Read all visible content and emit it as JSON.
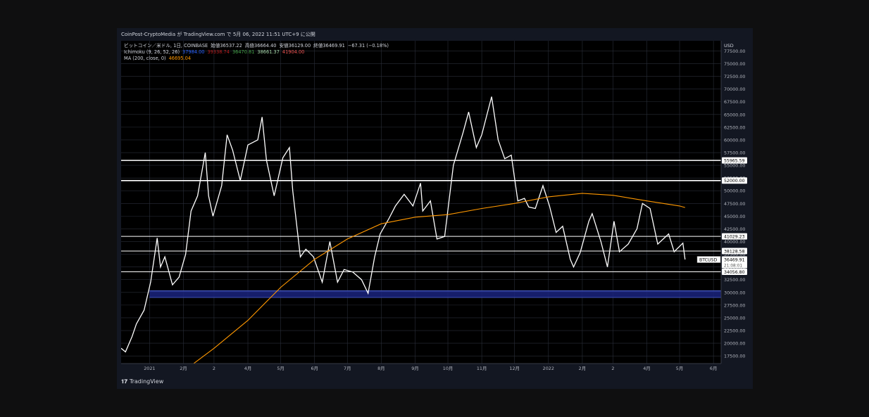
{
  "header": {
    "publisher": "CoinPost-CryptoMedia が TradingView.com で 5月 06, 2022 11:51 UTC+9 に公開"
  },
  "legend": {
    "symbol_line": "ビットコイン／米ドル, 1日, COINBASE",
    "ohlc": [
      {
        "label": "始値",
        "value": "36537.22"
      },
      {
        "label": "高値",
        "value": "36664.40"
      },
      {
        "label": "安値",
        "value": "36129.00"
      },
      {
        "label": "終値",
        "value": "36469.91"
      }
    ],
    "change": "−67.31 (−0.18%)",
    "ichimoku_label": "Ichimoku (9, 26, 52, 26)",
    "ichimoku_values": [
      {
        "value": "37984.00",
        "color": "#2962ff"
      },
      {
        "value": "39338.74",
        "color": "#b71c1c"
      },
      {
        "value": "36470.81",
        "color": "#43a047"
      },
      {
        "value": "38661.37",
        "color": "#a5d6a7"
      },
      {
        "value": "41904.00",
        "color": "#ef5350"
      }
    ],
    "ma_label": "MA (200, close, 0)",
    "ma_value": "46695.04",
    "ma_color": "#ff9800"
  },
  "currency": "USD",
  "footer": {
    "brand": "TradingView",
    "icon": "tradingview-logo-icon"
  },
  "chart_data": {
    "type": "line",
    "title": "",
    "xlabel": "",
    "ylabel": "",
    "ylim": [
      16000,
      79500
    ],
    "y_ticks": [
      17500,
      20000,
      22500,
      25000,
      27500,
      30000,
      32500,
      35000,
      37500,
      40000,
      42500,
      45000,
      47500,
      50000,
      52500,
      55000,
      57500,
      60000,
      62500,
      65000,
      67500,
      70000,
      72500,
      75000,
      77500
    ],
    "x_ticks": [
      {
        "label": "2021",
        "date": "2021-01-01"
      },
      {
        "label": "2月",
        "date": "2021-02-01"
      },
      {
        "label": "2",
        "date": "2021-03-01"
      },
      {
        "label": "4月",
        "date": "2021-04-01"
      },
      {
        "label": "5月",
        "date": "2021-05-01"
      },
      {
        "label": "6月",
        "date": "2021-06-01"
      },
      {
        "label": "7月",
        "date": "2021-07-01"
      },
      {
        "label": "8月",
        "date": "2021-08-01"
      },
      {
        "label": "9月",
        "date": "2021-09-01"
      },
      {
        "label": "10月",
        "date": "2021-10-01"
      },
      {
        "label": "11月",
        "date": "2021-11-01"
      },
      {
        "label": "12月",
        "date": "2021-12-01"
      },
      {
        "label": "2022",
        "date": "2022-01-01"
      },
      {
        "label": "2月",
        "date": "2022-02-01"
      },
      {
        "label": "2",
        "date": "2022-03-01"
      },
      {
        "label": "4月",
        "date": "2022-04-01"
      },
      {
        "label": "5月",
        "date": "2022-05-01"
      },
      {
        "label": "6月",
        "date": "2022-06-01"
      }
    ],
    "x_range": [
      "2020-12-06",
      "2022-06-08"
    ],
    "horizontal_levels": [
      {
        "value": 55965.59,
        "label": "55965.59"
      },
      {
        "value": 52000.0,
        "label": "52000.00"
      },
      {
        "value": 41029.23,
        "label": "41029.23"
      },
      {
        "value": 38128.58,
        "label": "38128.58"
      },
      {
        "value": 34056.8,
        "label": "34056.80"
      }
    ],
    "support_zone": {
      "from": 29000,
      "to": 30300,
      "color": "#1a237e"
    },
    "price_tag": {
      "symbol": "BTCUSD",
      "value": "36469.91",
      "countdown": "21:08:01"
    },
    "series": [
      {
        "name": "BTCUSD",
        "color": "#ffffff",
        "points": [
          [
            "2020-12-06",
            19000
          ],
          [
            "2020-12-10",
            18300
          ],
          [
            "2020-12-16",
            21300
          ],
          [
            "2020-12-20",
            23800
          ],
          [
            "2020-12-27",
            26500
          ],
          [
            "2021-01-02",
            32000
          ],
          [
            "2021-01-08",
            40700
          ],
          [
            "2021-01-11",
            35000
          ],
          [
            "2021-01-15",
            37000
          ],
          [
            "2021-01-22",
            31500
          ],
          [
            "2021-01-28",
            33000
          ],
          [
            "2021-02-03",
            37500
          ],
          [
            "2021-02-08",
            46000
          ],
          [
            "2021-02-14",
            49000
          ],
          [
            "2021-02-21",
            57500
          ],
          [
            "2021-02-24",
            49000
          ],
          [
            "2021-02-28",
            45000
          ],
          [
            "2021-03-08",
            51000
          ],
          [
            "2021-03-13",
            61000
          ],
          [
            "2021-03-18",
            58000
          ],
          [
            "2021-03-25",
            52000
          ],
          [
            "2021-04-01",
            59000
          ],
          [
            "2021-04-10",
            60000
          ],
          [
            "2021-04-14",
            64500
          ],
          [
            "2021-04-18",
            56000
          ],
          [
            "2021-04-25",
            49000
          ],
          [
            "2021-05-03",
            56500
          ],
          [
            "2021-05-09",
            58500
          ],
          [
            "2021-05-12",
            50000
          ],
          [
            "2021-05-19",
            37000
          ],
          [
            "2021-05-24",
            38500
          ],
          [
            "2021-05-31",
            37000
          ],
          [
            "2021-06-08",
            32000
          ],
          [
            "2021-06-15",
            40000
          ],
          [
            "2021-06-22",
            32000
          ],
          [
            "2021-06-28",
            34500
          ],
          [
            "2021-07-06",
            34000
          ],
          [
            "2021-07-14",
            32500
          ],
          [
            "2021-07-20",
            29800
          ],
          [
            "2021-07-26",
            37000
          ],
          [
            "2021-07-31",
            41500
          ],
          [
            "2021-08-08",
            44500
          ],
          [
            "2021-08-14",
            47000
          ],
          [
            "2021-08-22",
            49300
          ],
          [
            "2021-08-30",
            47000
          ],
          [
            "2021-09-06",
            51500
          ],
          [
            "2021-09-08",
            46000
          ],
          [
            "2021-09-15",
            48000
          ],
          [
            "2021-09-21",
            40500
          ],
          [
            "2021-09-28",
            41000
          ],
          [
            "2021-10-06",
            55000
          ],
          [
            "2021-10-15",
            61500
          ],
          [
            "2021-10-20",
            65500
          ],
          [
            "2021-10-27",
            58500
          ],
          [
            "2021-11-01",
            61000
          ],
          [
            "2021-11-10",
            68500
          ],
          [
            "2021-11-16",
            60000
          ],
          [
            "2021-11-22",
            56300
          ],
          [
            "2021-11-28",
            57000
          ],
          [
            "2021-12-04",
            48000
          ],
          [
            "2021-12-10",
            48500
          ],
          [
            "2021-12-14",
            46800
          ],
          [
            "2021-12-20",
            46500
          ],
          [
            "2021-12-27",
            51000
          ],
          [
            "2022-01-02",
            47000
          ],
          [
            "2022-01-08",
            41800
          ],
          [
            "2022-01-14",
            43000
          ],
          [
            "2022-01-21",
            36500
          ],
          [
            "2022-01-24",
            35000
          ],
          [
            "2022-01-30",
            37800
          ],
          [
            "2022-02-07",
            44000
          ],
          [
            "2022-02-10",
            45500
          ],
          [
            "2022-02-18",
            40000
          ],
          [
            "2022-02-24",
            35000
          ],
          [
            "2022-03-02",
            44000
          ],
          [
            "2022-03-07",
            38000
          ],
          [
            "2022-03-15",
            39500
          ],
          [
            "2022-03-23",
            42500
          ],
          [
            "2022-03-28",
            47500
          ],
          [
            "2022-04-04",
            46500
          ],
          [
            "2022-04-11",
            39500
          ],
          [
            "2022-04-21",
            41500
          ],
          [
            "2022-04-26",
            38000
          ],
          [
            "2022-05-04",
            39700
          ],
          [
            "2022-05-06",
            36470
          ]
        ]
      },
      {
        "name": "MA (200, close, 0)",
        "color": "#ff9800",
        "points": [
          [
            "2021-01-10",
            12000
          ],
          [
            "2021-02-01",
            14500
          ],
          [
            "2021-03-01",
            19000
          ],
          [
            "2021-04-01",
            24500
          ],
          [
            "2021-05-01",
            31000
          ],
          [
            "2021-06-01",
            36500
          ],
          [
            "2021-07-01",
            40500
          ],
          [
            "2021-08-01",
            43500
          ],
          [
            "2021-09-01",
            44800
          ],
          [
            "2021-10-01",
            45300
          ],
          [
            "2021-11-01",
            46500
          ],
          [
            "2021-12-01",
            47500
          ],
          [
            "2022-01-01",
            48800
          ],
          [
            "2022-02-01",
            49500
          ],
          [
            "2022-03-01",
            49100
          ],
          [
            "2022-04-01",
            48000
          ],
          [
            "2022-05-01",
            47000
          ],
          [
            "2022-05-06",
            46695
          ]
        ]
      }
    ]
  }
}
